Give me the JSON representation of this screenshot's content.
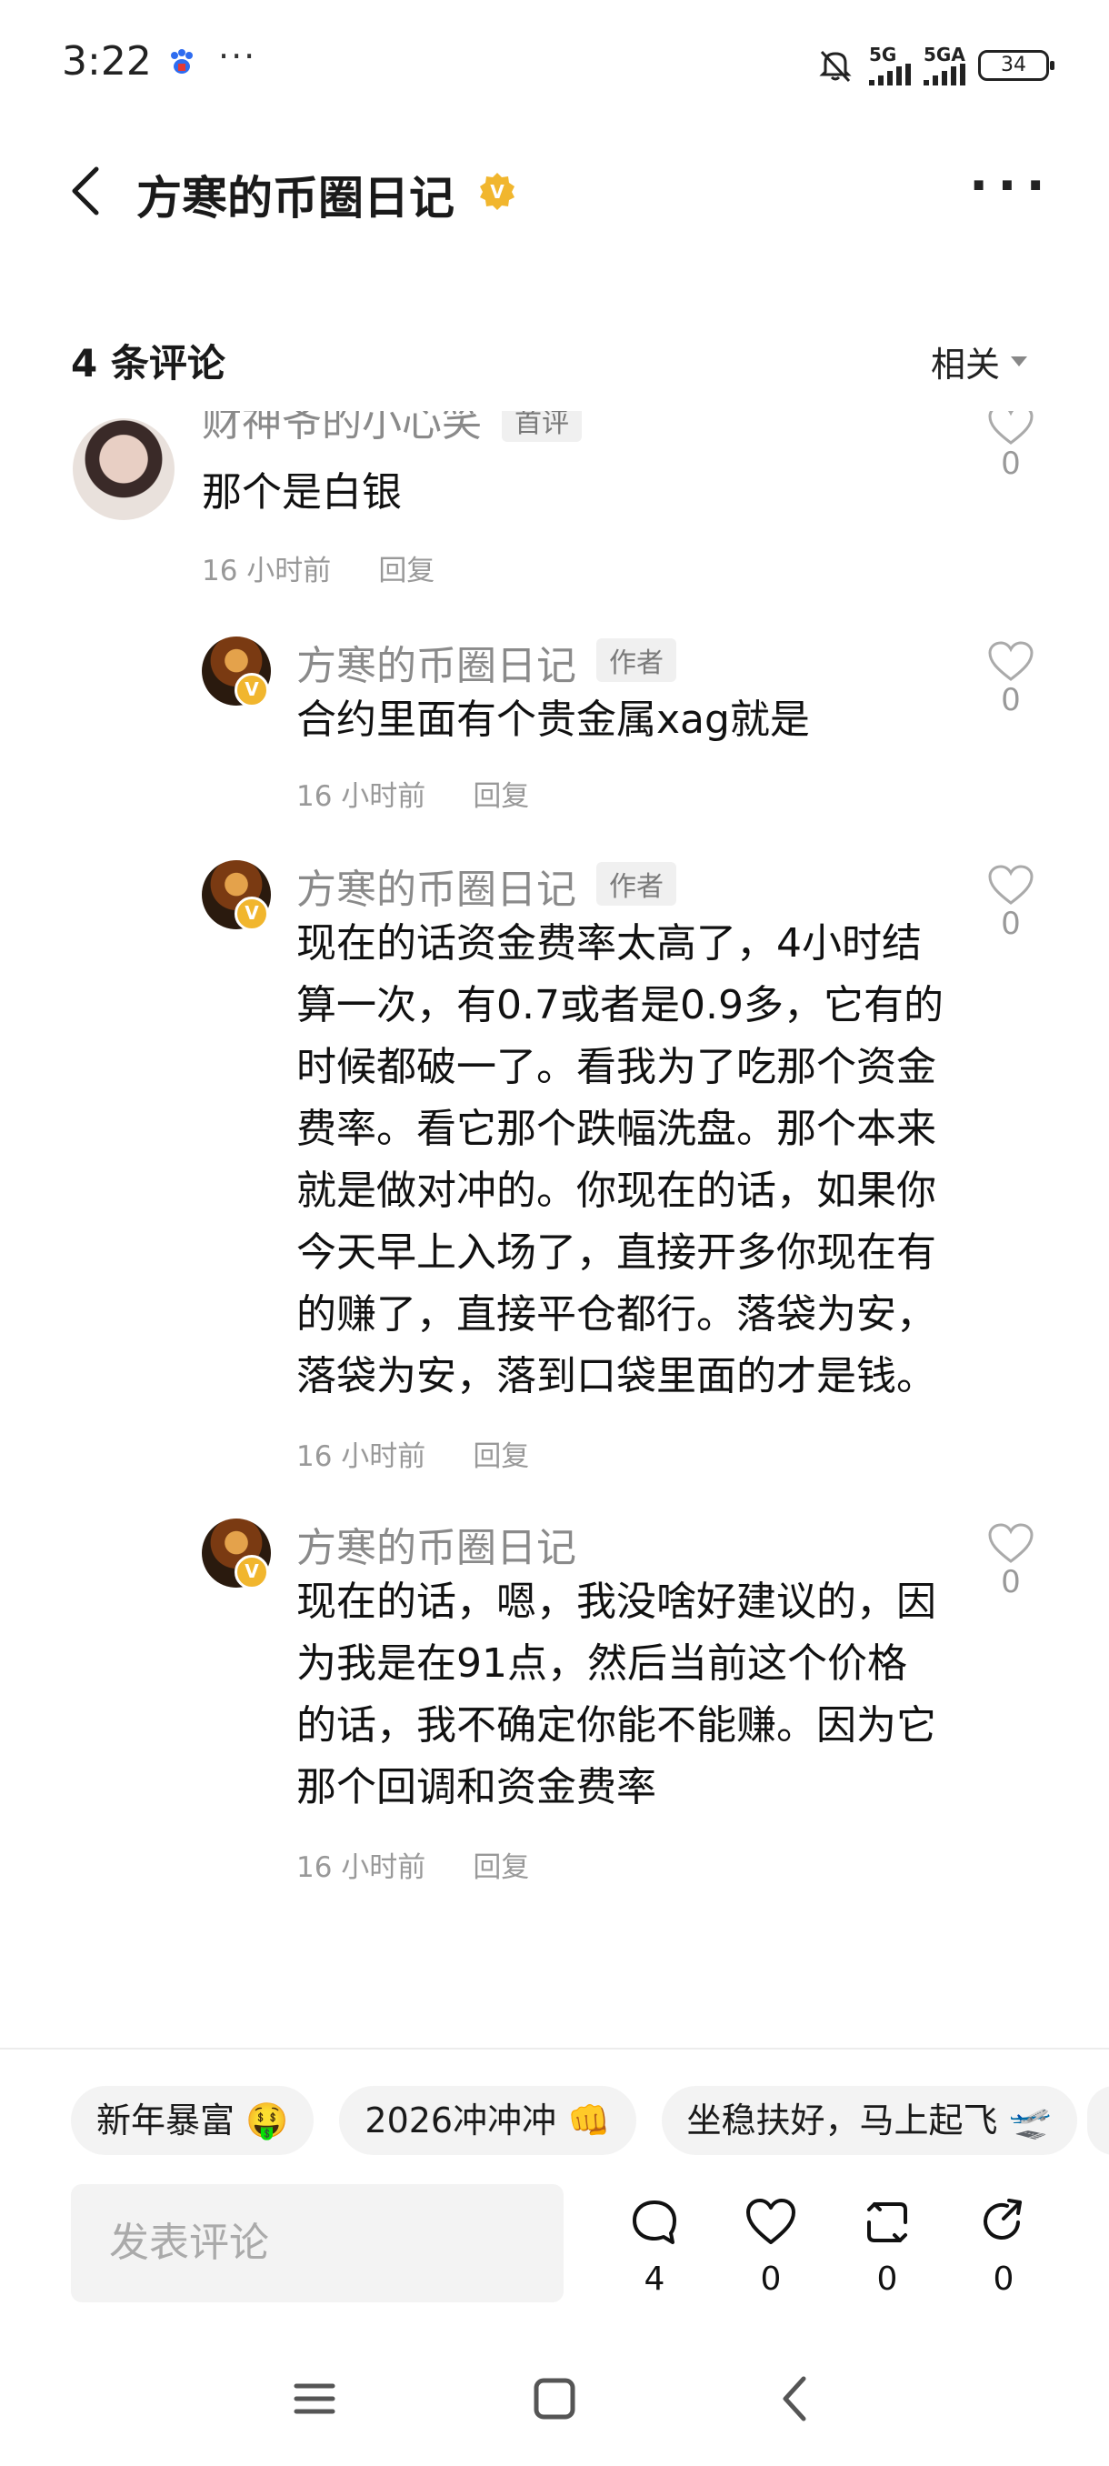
{
  "status_bar": {
    "time": "3:22",
    "dots": "···",
    "net1": "5G",
    "net2": "5GA",
    "battery": "34",
    "icons": [
      "baidu-app-icon",
      "mute-icon",
      "signal-icon",
      "signal-icon",
      "battery-icon"
    ]
  },
  "header": {
    "title": "方寒的币圈日记",
    "more": "···",
    "icons": [
      "back-arrow-icon",
      "verified-badge-icon",
      "more-icon"
    ]
  },
  "comments_bar": {
    "count": "4 条评论",
    "sort": "相关"
  },
  "comments": [
    {
      "name": "财神爷的小心笑",
      "tag": "首评",
      "text": "那个是白银",
      "time": "16 小时前",
      "reply": "回复",
      "likes": "0"
    },
    {
      "name": "方寒的币圈日记",
      "tag": "作者",
      "text": "合约里面有个贵金属xag就是",
      "time": "16 小时前",
      "reply": "回复",
      "likes": "0"
    },
    {
      "name": "方寒的币圈日记",
      "tag": "作者",
      "lines": [
        "现在的话资金费率太高了，4小时结",
        "算一次，有0.7或者是0.9多，它有的",
        "时候都破一了。看我为了吃那个资金",
        "费率。看它那个跌幅洗盘。那个本来",
        "就是做对冲的。你现在的话，如果你",
        "今天早上入场了，直接开多你现在有",
        "的赚了，直接平仓都行。落袋为安，",
        "落袋为安，落到口袋里面的才是钱。"
      ],
      "time": "16 小时前",
      "reply": "回复",
      "likes": "0"
    },
    {
      "name": "方寒的币圈日记",
      "lines": [
        "现在的话，嗯，我没啥好建议的，因",
        "为我是在91点，然后当前这个价格",
        "的话，我不确定你能不能赚。因为它",
        "那个回调和资金费率"
      ],
      "time": "16 小时前",
      "reply": "回复",
      "likes": "0"
    }
  ],
  "chips": [
    "新年暴富 🤑",
    "2026冲冲冲 👊",
    "坐稳扶好，马上起飞 🛫"
  ],
  "input": {
    "placeholder": "发表评论"
  },
  "actions": [
    {
      "icon": "comment-icon",
      "count": "4"
    },
    {
      "icon": "heart-icon",
      "count": "0"
    },
    {
      "icon": "repost-icon",
      "count": "0"
    },
    {
      "icon": "share-icon",
      "count": "0"
    }
  ],
  "nav_icons": [
    "menu-icon",
    "home-icon",
    "back-icon"
  ],
  "colors": {
    "badge": "#f1b62e",
    "text": "#111111",
    "muted": "#999999"
  }
}
